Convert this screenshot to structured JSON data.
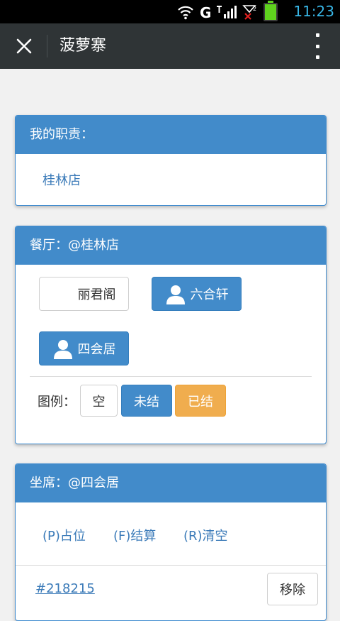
{
  "status_bar": {
    "time": "11:23",
    "icons": [
      "wifi-icon",
      "signal-g-icon",
      "signal-bars-icon",
      "no-signal-icon",
      "battery-icon"
    ],
    "time_color": "#38b6e6"
  },
  "title_bar": {
    "title": "菠萝寨",
    "close_icon": "close-icon",
    "menu_icon": "more-vert-icon"
  },
  "duty_panel": {
    "heading": "我的职责：",
    "store": "桂林店"
  },
  "restaurant_panel": {
    "heading": "餐厅：@桂林店",
    "rooms": [
      {
        "label": "丽君阁",
        "state": "empty"
      },
      {
        "label": "六合轩",
        "state": "occupied"
      },
      {
        "label": "四会居",
        "state": "occupied"
      }
    ],
    "legend_label": "图例：",
    "legend": {
      "empty": "空",
      "unsettled": "未结",
      "settled": "已结"
    }
  },
  "seat_panel": {
    "heading": "坐席：@四会居",
    "actions": {
      "occupy": "(P)占位",
      "settle": "(F)结算",
      "clear": "(R)清空"
    },
    "orders": [
      {
        "id": "#218215",
        "remove": "移除"
      }
    ]
  },
  "colors": {
    "primary": "#428bca",
    "warning": "#f0ad4e",
    "titlebar": "#2f3436"
  }
}
